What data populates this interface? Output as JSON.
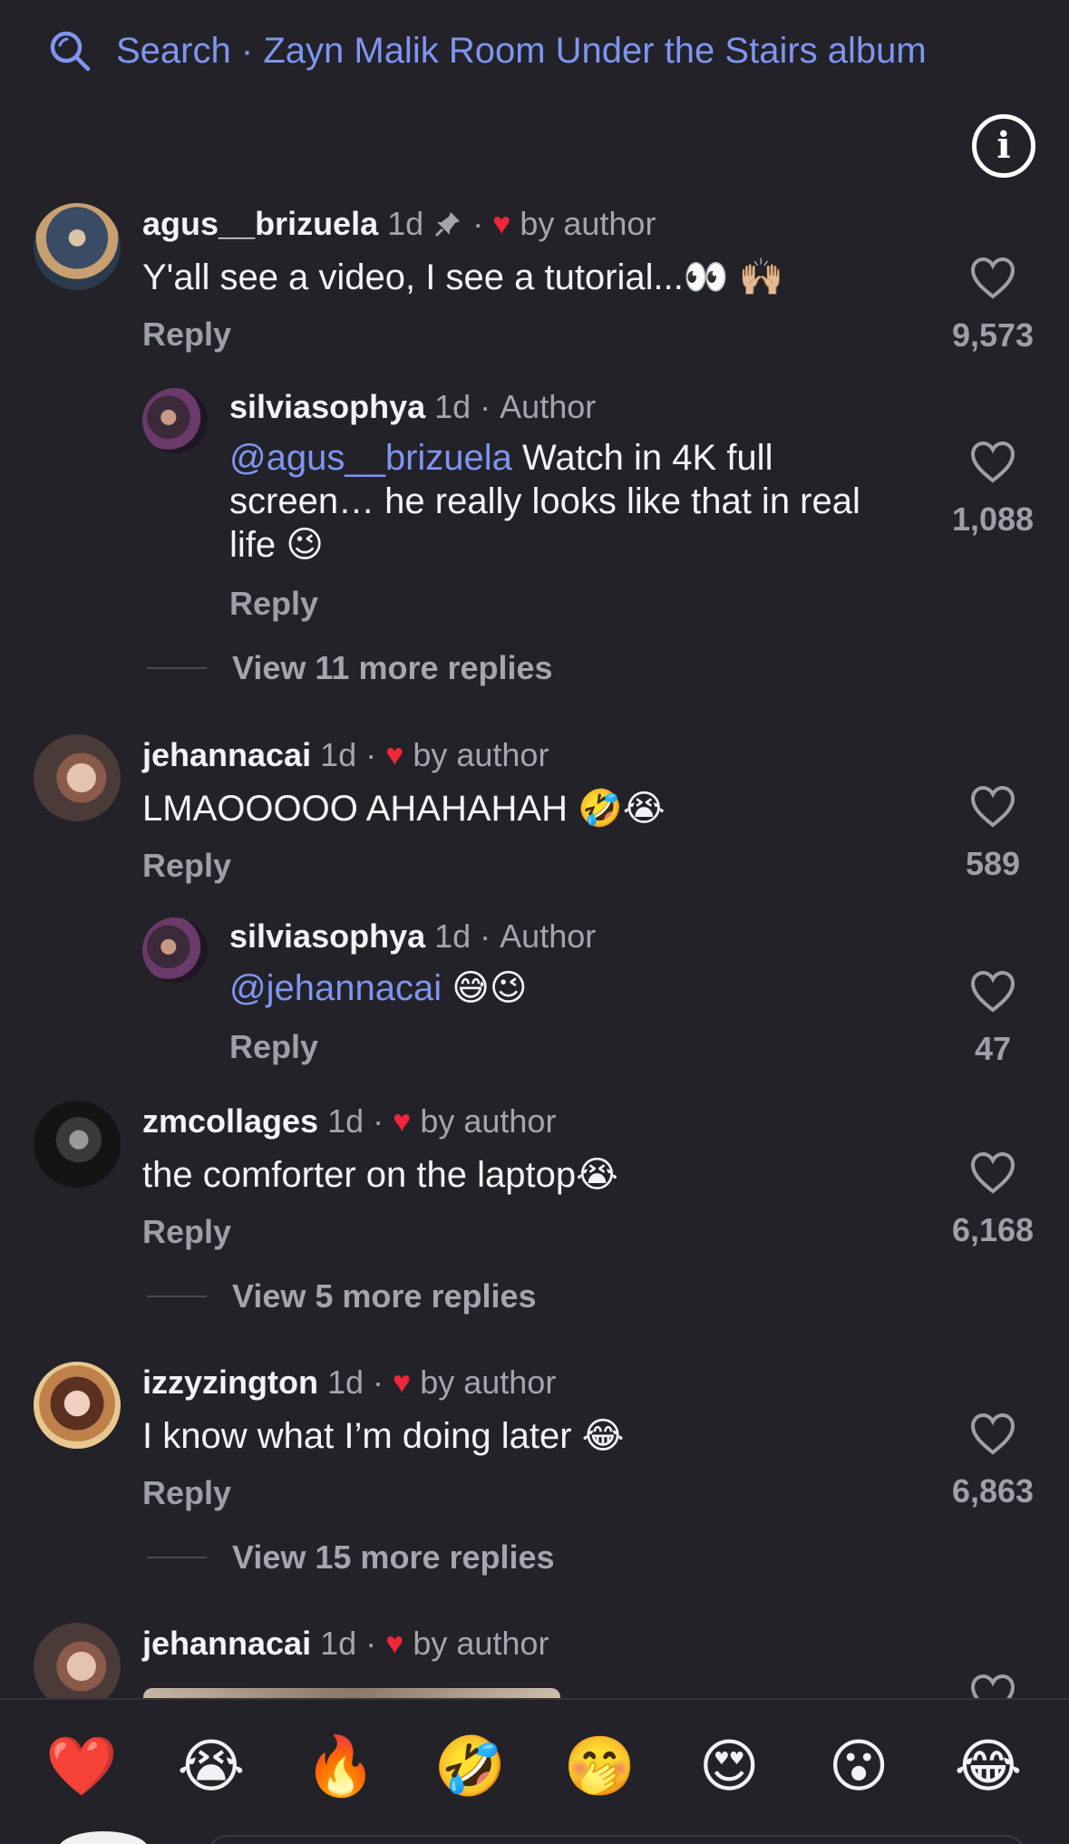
{
  "search": {
    "label": "Search",
    "separator": "·",
    "query": "Zayn Malik Room Under the Stairs album"
  },
  "colors": {
    "background": "#222228",
    "accent": "#7f95f0",
    "like_red": "#f0263a"
  },
  "icons": {
    "search": "search-icon",
    "info": "info-icon",
    "pin": "pin-icon",
    "heart": "heart-outline-icon",
    "heart_filled": "heart-filled-icon"
  },
  "comments": [
    {
      "username": "agus__brizuela",
      "age": "1d",
      "meta": "by author",
      "text": "Y'all see a video, I see a tutorial...👀 🙌🏼",
      "reply": "Reply",
      "likes": "9,573"
    },
    {
      "username": "silviasophya",
      "age": "1d",
      "meta": "Author",
      "mention": "@agus__brizuela",
      "text_line1": "Watch in 4K full",
      "text_line2": "screen… he really looks like that in real",
      "text_line3": "life 😉",
      "reply": "Reply",
      "likes": "1,088"
    },
    {
      "username": "jehannacai",
      "age": "1d",
      "meta": "by author",
      "text": "LMAOOOOO AHAHAHAH 🤣😭",
      "reply": "Reply",
      "likes": "589"
    },
    {
      "username": "silviasophya",
      "age": "1d",
      "meta": "Author",
      "mention": "@jehannacai",
      "text": "😅😉",
      "reply": "Reply",
      "likes": "47"
    },
    {
      "username": "zmcollages",
      "age": "1d",
      "meta": "by author",
      "text": "the comforter on the laptop😭",
      "reply": "Reply",
      "likes": "6,168"
    },
    {
      "username": "izzyzington",
      "age": "1d",
      "meta": "by author",
      "text": "I know what I’m doing later 😂",
      "reply": "Reply",
      "likes": "6,863"
    },
    {
      "username": "jehannacai",
      "age": "1d",
      "meta": "by author"
    }
  ],
  "view_more": [
    "View 11 more replies",
    "View 5 more replies",
    "View 15 more replies"
  ],
  "quick_reactions": [
    "❤️",
    "😭",
    "🔥",
    "🤣",
    "🤭",
    "😍",
    "😮",
    "😂"
  ]
}
